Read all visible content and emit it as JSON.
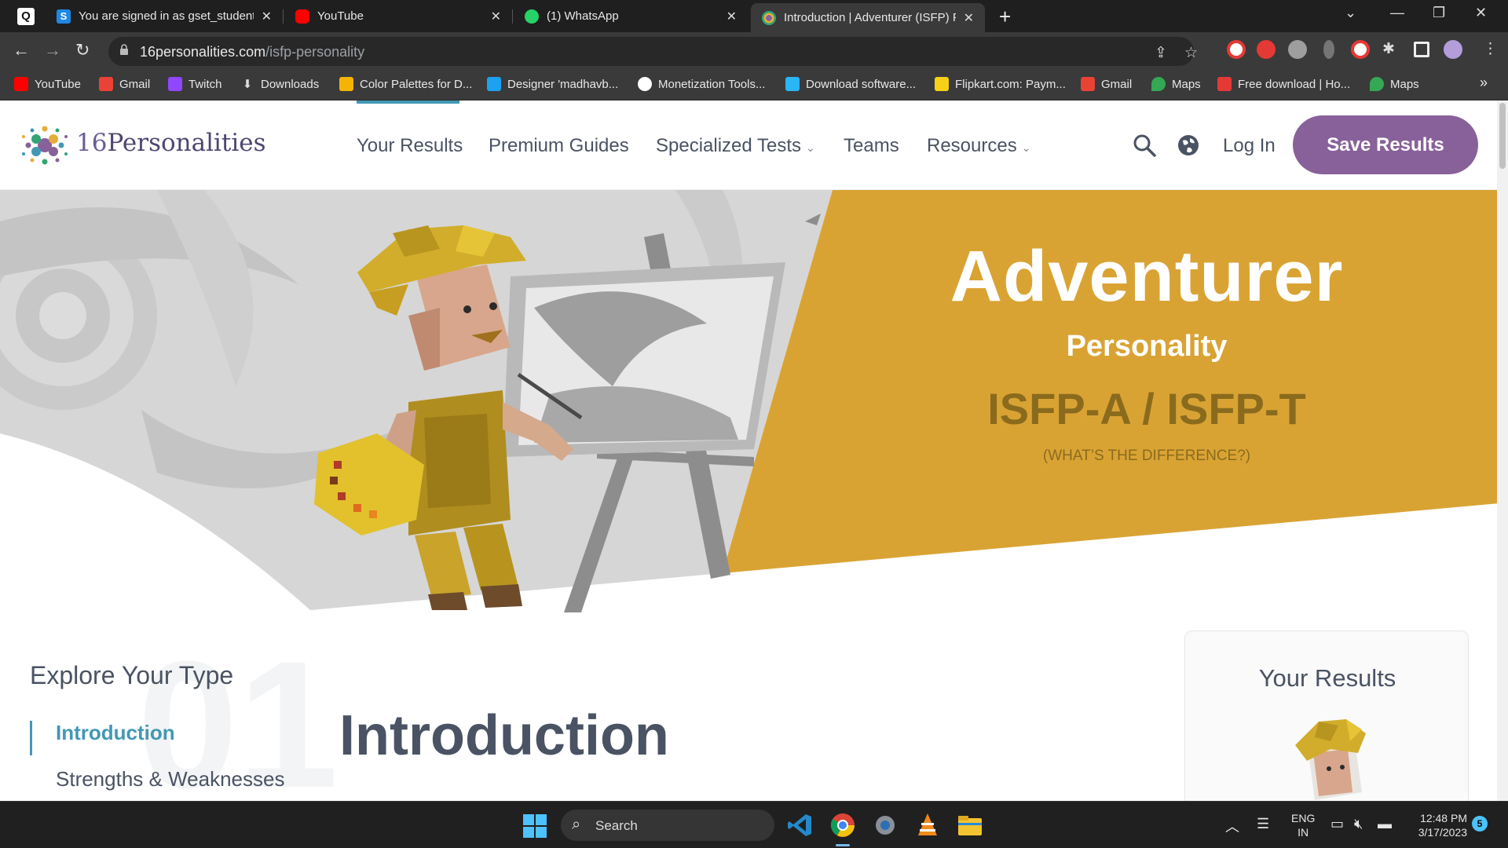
{
  "browser": {
    "tabs": [
      {
        "title": "You are signed in as gset_student",
        "favicon_color": "#1e88e5",
        "active": false
      },
      {
        "title": "YouTube",
        "favicon_color": "#ff0000",
        "active": false
      },
      {
        "title": "(1) WhatsApp",
        "favicon_color": "#25d366",
        "active": false
      },
      {
        "title": "Introduction | Adventurer (ISFP) P",
        "favicon_color": "#88619a",
        "active": true
      }
    ],
    "url_host": "16personalities.com",
    "url_path": "/isfp-personality",
    "bookmarks": [
      {
        "label": "YouTube",
        "color": "#ff0000"
      },
      {
        "label": "Gmail",
        "color": "#ea4335"
      },
      {
        "label": "Twitch",
        "color": "#9146ff"
      },
      {
        "label": "Downloads",
        "color": "#dddddd"
      },
      {
        "label": "Color Palettes for D...",
        "color": "#f4b400"
      },
      {
        "label": "Designer 'madhavb...",
        "color": "#1da1f2"
      },
      {
        "label": "Monetization Tools...",
        "color": "#ffffff"
      },
      {
        "label": "Download software...",
        "color": "#29b6f6"
      },
      {
        "label": "Flipkart.com: Paym...",
        "color": "#f7d117"
      },
      {
        "label": "Gmail",
        "color": "#ea4335"
      },
      {
        "label": "Maps",
        "color": "#34a853"
      },
      {
        "label": "Free download | Ho...",
        "color": "#e53935"
      },
      {
        "label": "Maps",
        "color": "#34a853"
      }
    ],
    "bookmarks_more": "»"
  },
  "site": {
    "logo_number": "16",
    "logo_word": "Personalities",
    "nav": [
      {
        "label": "Your Results",
        "active": true
      },
      {
        "label": "Premium Guides"
      },
      {
        "label": "Specialized Tests",
        "caret": "⌄"
      },
      {
        "label": "Teams"
      },
      {
        "label": "Resources",
        "caret": "⌄"
      }
    ],
    "login": "Log In",
    "save": "Save Results",
    "accent": "#88619a",
    "link_color": "#4298b4"
  },
  "hero": {
    "title": "Adventurer",
    "subtitle": "Personality",
    "code": "ISFP-A / ISFP-T",
    "diff_link": "(WHAT’S THE DIFFERENCE?)",
    "banner_color": "#d9a334"
  },
  "content": {
    "explore_title": "Explore Your Type",
    "section_number": "01",
    "sidebar": [
      {
        "label": "Introduction",
        "active": true
      },
      {
        "label": "Strengths & Weaknesses"
      }
    ],
    "heading": "Introduction",
    "results_card_title": "Your Results"
  },
  "taskbar": {
    "search": "Search",
    "lang_top": "ENG",
    "lang_bottom": "IN",
    "time": "12:48 PM",
    "date": "3/17/2023",
    "notifications": "5"
  }
}
